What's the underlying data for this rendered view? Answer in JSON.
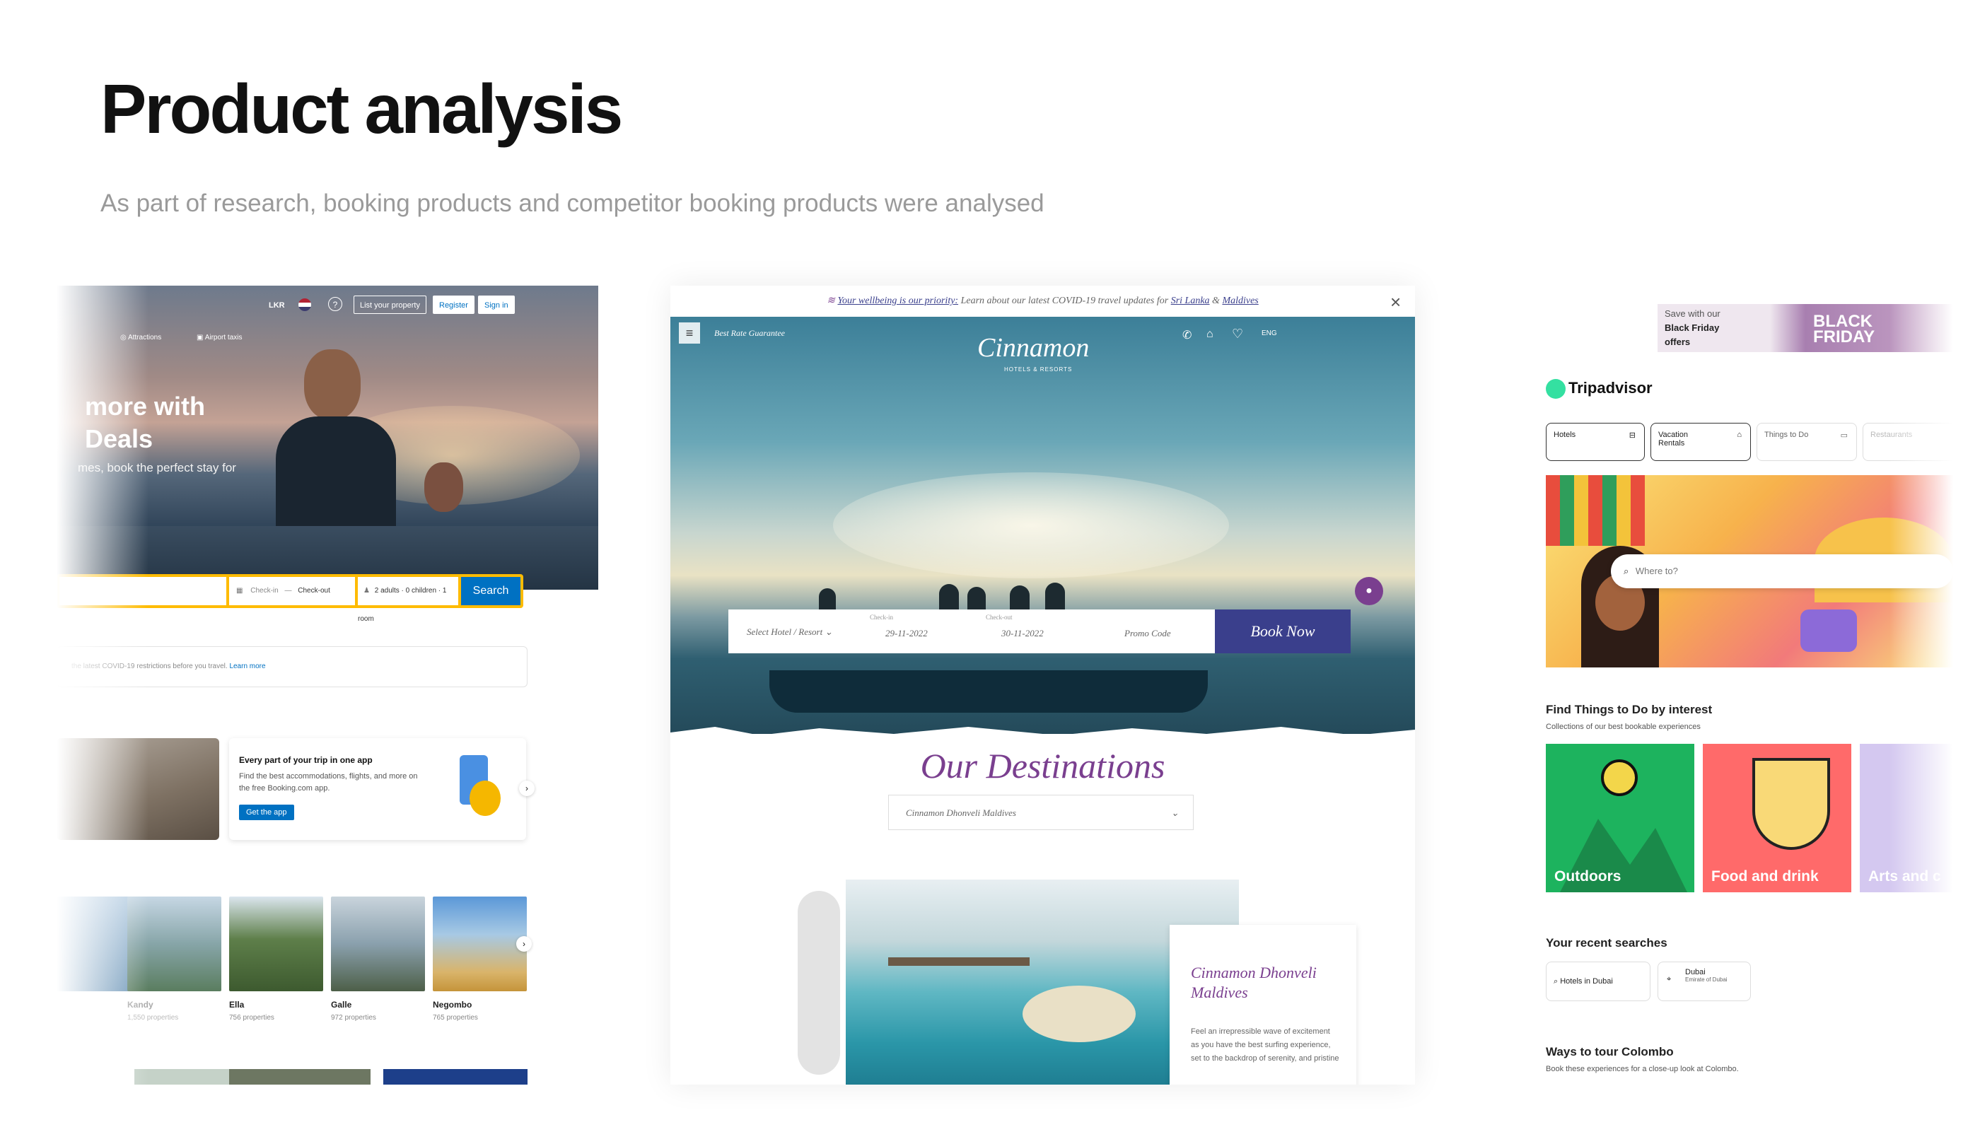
{
  "header": {
    "title": "Product analysis",
    "subtitle": "As part of research, booking products and competitor booking products were analysed"
  },
  "booking": {
    "currency": "LKR",
    "help_glyph": "?",
    "list_property": "List your property",
    "register": "Register",
    "signin": "Sign in",
    "nav": [
      "Attractions",
      "Airport taxis"
    ],
    "hero_line1": "more with",
    "hero_line2": "Deals",
    "hero_sub": "mes, book the perfect stay for",
    "checkin": "Check-in",
    "checkout": "Check-out",
    "guests": "2 adults · 0 children · 1 room",
    "search": "Search",
    "covid": "the latest COVID-19 restrictions before you travel.",
    "covid_link": "Learn more",
    "app_title": "Every part of your trip in one app",
    "app_text": "Find the best accommodations, flights, and more on the free Booking.com app.",
    "app_button": "Get the app",
    "destinations": [
      {
        "name": "Kandy",
        "count": "1,550 properties"
      },
      {
        "name": "Ella",
        "count": "756 properties"
      },
      {
        "name": "Galle",
        "count": "972 properties"
      },
      {
        "name": "Negombo",
        "count": "765 properties"
      }
    ],
    "colors": {
      "brand": "#003580",
      "accent": "#0071c2",
      "highlight": "#febb02"
    }
  },
  "cinnamon": {
    "banner_prefix": "Your wellbeing is our priority:",
    "banner_text": "Learn about our latest COVID-19 travel updates for",
    "banner_link1": "Sri Lanka",
    "banner_amp": "&",
    "banner_link2": "Maldives",
    "best_rate": "Best Rate Guarantee",
    "logo": "Cinnamon",
    "logo_sub": "HOTELS & RESORTS",
    "lang": "ENG",
    "select_hotel": "Select Hotel / Resort",
    "checkin_label": "Check-in",
    "checkin_value": "29-11-2022",
    "checkout_label": "Check-out",
    "checkout_value": "30-11-2022",
    "promo": "Promo Code",
    "book_now": "Book Now",
    "section_title": "Our Destinations",
    "dropdown_value": "Cinnamon Dhonveli Maldives",
    "card_title": "Cinnamon Dhonveli Maldives",
    "card_text": "Feel an irrepressible wave of excitement as you have the best surfing experience, set to the backdrop of serenity, and pristine",
    "colors": {
      "accent": "#7a3f8f",
      "book": "#3a3f8c"
    }
  },
  "tripadvisor": {
    "ad_line1": "Save with our",
    "ad_line2": "Black Friday",
    "ad_line3": "offers",
    "ad_banner": "BLACK FRIDAY",
    "logo": "Tripadvisor",
    "tabs": [
      "Hotels",
      "Vacation Rentals",
      "Things to Do",
      "Restaurants"
    ],
    "search_placeholder": "Where to?",
    "interest_title": "Find Things to Do by interest",
    "interest_sub": "Collections of our best bookable experiences",
    "tiles": [
      "Outdoors",
      "Food and drink",
      "Arts and c"
    ],
    "recent_title": "Your recent searches",
    "recent": [
      {
        "title": "Hotels in Dubai",
        "sub": ""
      },
      {
        "title": "Dubai",
        "sub": "Emirate of Dubai"
      }
    ],
    "ways_title": "Ways to tour Colombo",
    "ways_sub": "Book these experiences for a close-up look at Colombo.",
    "colors": {
      "brand": "#34e0a1",
      "outdoors": "#1db35e",
      "food": "#ff6a6a",
      "arts": "#d4c8f0"
    }
  }
}
